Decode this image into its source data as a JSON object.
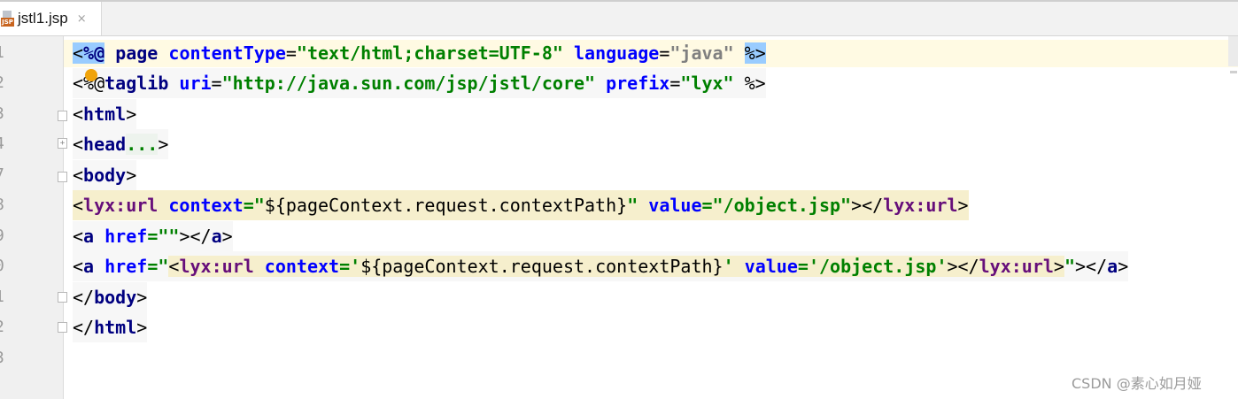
{
  "tab": {
    "title": "jstl1.jsp",
    "close": "×",
    "icon_badge": "JSP"
  },
  "gutter": {
    "line_numbers": [
      "1",
      "2",
      "3",
      "4",
      "7",
      "8",
      "9",
      "0",
      "1",
      "2",
      "3"
    ]
  },
  "code": {
    "l1": {
      "lt": "<",
      "pct": "%@",
      "sp1": " ",
      "kw": "page",
      "sp2": " ",
      "a1": "contentType",
      "eq1": "=",
      "v1": "\"text/html;charset=UTF-8\"",
      "sp3": " ",
      "a2": "language",
      "eq2": "=",
      "v2": "\"java\"",
      "sp4": " ",
      "end": "%>"
    },
    "l2": {
      "open": "<%@",
      "kw": "taglib",
      "sp1": " ",
      "a1": "uri",
      "eq1": "=",
      "v1": "\"http://java.sun.com/jsp/jstl/core\"",
      "sp2": " ",
      "a2": "prefix",
      "eq2": "=",
      "v2": "\"lyx\"",
      "sp3": " ",
      "end": "%>"
    },
    "l3": {
      "open": "<",
      "tag": "html",
      "close": ">"
    },
    "l4": {
      "open": "<",
      "tag": "head",
      "dots": "...",
      "close": ">"
    },
    "l5": {
      "open": "<",
      "tag": "body",
      "close": ">"
    },
    "l6": {
      "open": "<",
      "tag": "lyx:url",
      "sp1": " ",
      "a1": "context",
      "eq1": "=",
      "q1": "\"",
      "el": "${pageContext.request.contextPath}",
      "q2": "\"",
      "sp2": " ",
      "a2": "value",
      "eq2": "=",
      "v2": "\"/object.jsp\"",
      "mid": "></",
      "ctag": "lyx:url",
      "close": ">"
    },
    "l7": {
      "open": "<",
      "tag": "a",
      "sp1": " ",
      "a1": "href",
      "eq1": "=",
      "v1": "\"\"",
      "mid": "></",
      "ctag": "a",
      "close": ">"
    },
    "l8": {
      "open": "<",
      "tag": "a",
      "sp1": " ",
      "a1": "href",
      "eq1": "=",
      "q1": "\"",
      "iopen": "<",
      "itag": "lyx:url",
      "sp2": " ",
      "a2": "context",
      "eq2": "=",
      "sq1": "'",
      "el": "${pageContext.request.contextPath}",
      "sq2": "'",
      "sp3": " ",
      "a3": "value",
      "eq3": "=",
      "v3": "'/object.jsp'",
      "imid": "></",
      "ictag": "lyx:url",
      "iclose": ">",
      "q2": "\"",
      "mid": "></",
      "ctag": "a",
      "close": ">"
    },
    "l9": {
      "open": "</",
      "tag": "body",
      "close": ">"
    },
    "l10": {
      "open": "</",
      "tag": "html",
      "close": ">"
    }
  },
  "watermark": "CSDN @素心如月娅",
  "colors": {
    "keyword": "#000080",
    "attribute": "#0000ff",
    "string": "#008000",
    "tag_highlight": "#f6efcd",
    "caret_line": "#fffae3"
  }
}
